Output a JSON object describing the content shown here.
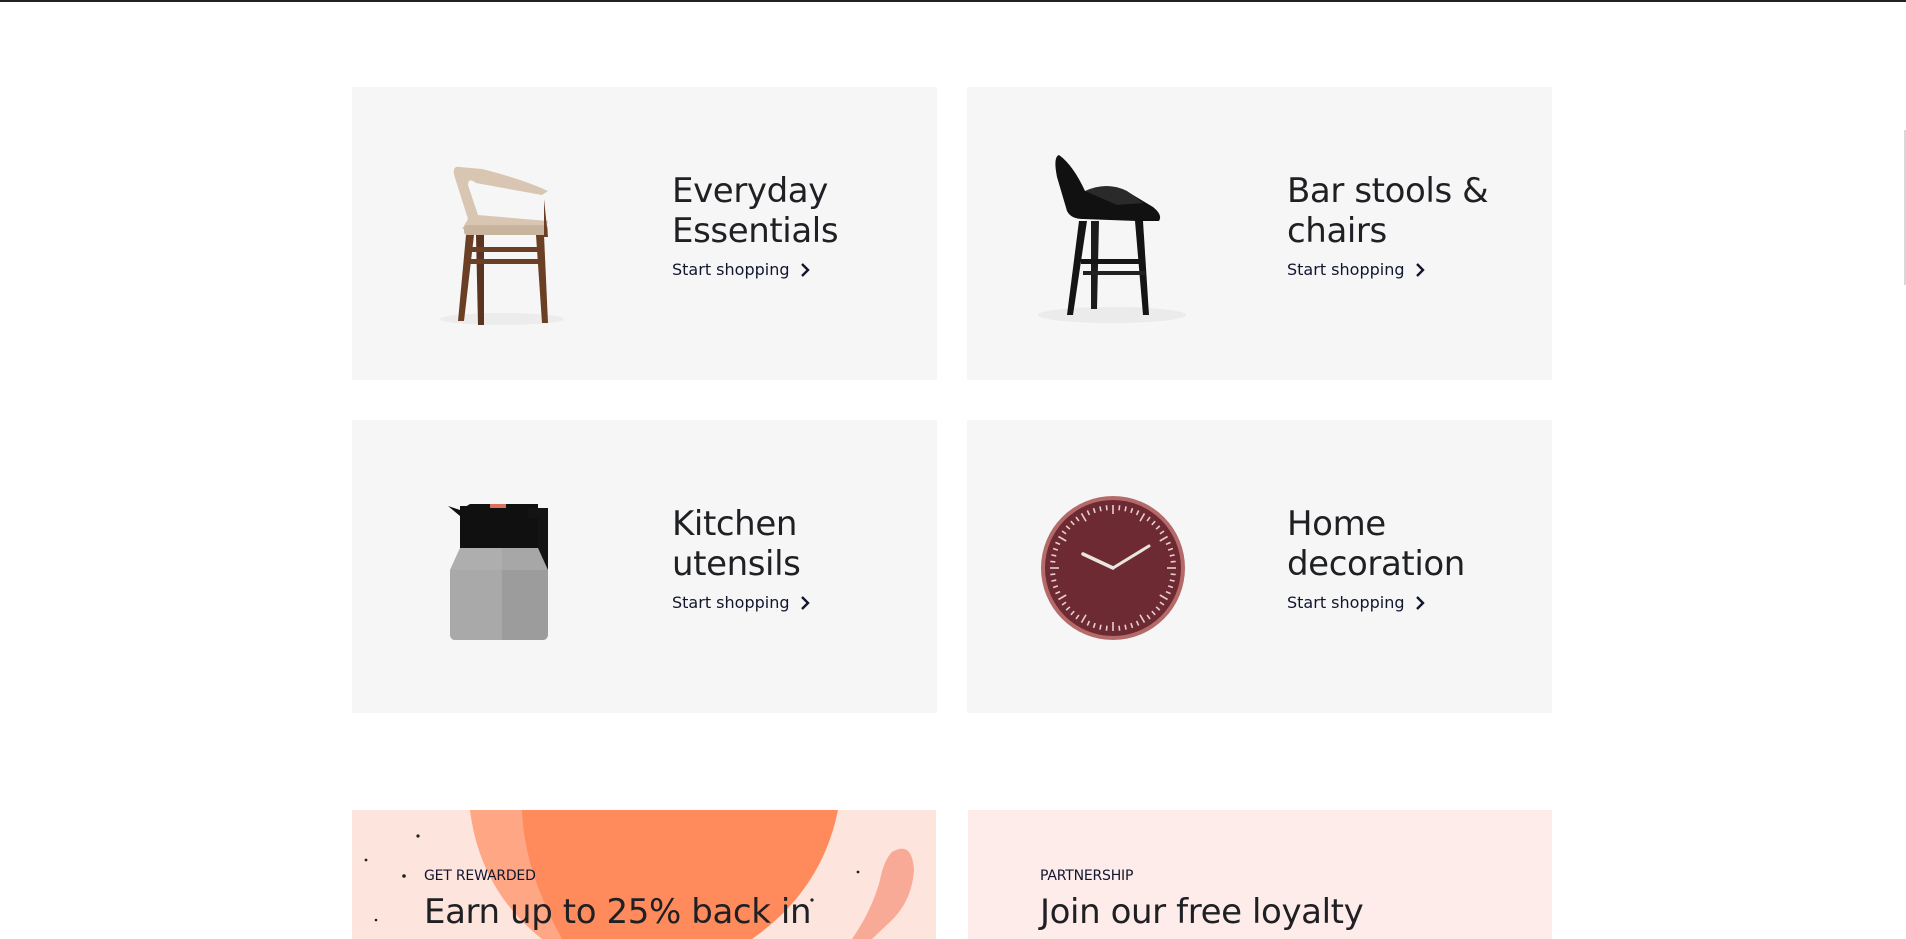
{
  "categories": [
    {
      "title_line1": "Everyday",
      "title_line2": "Essentials",
      "cta": "Start shopping",
      "icon": "chair-icon",
      "chevron": "chevron-right-icon"
    },
    {
      "title_line1": "Bar stools &",
      "title_line2": "chairs",
      "cta": "Start shopping",
      "icon": "armchair-icon",
      "chevron": "chevron-right-icon"
    },
    {
      "title_line1": "Kitchen",
      "title_line2": "utensils",
      "cta": "Start shopping",
      "icon": "jug-icon",
      "chevron": "chevron-right-icon"
    },
    {
      "title_line1": "Home",
      "title_line2": "decoration",
      "cta": "Start shopping",
      "icon": "clock-icon",
      "chevron": "chevron-right-icon"
    }
  ],
  "promos": {
    "rewards": {
      "eyebrow": "GET REWARDED",
      "headline": "Earn up to 25% back in"
    },
    "partnership": {
      "eyebrow": "PARTNERSHIP",
      "headline": "Join our free loyalty"
    }
  },
  "colors": {
    "card_bg": "#f6f6f6",
    "cta_text": "#11152e",
    "rewards_bg": "#fde4dc",
    "rewards_accent": "#ff8a5c",
    "partnership_bg": "#fdecea"
  }
}
